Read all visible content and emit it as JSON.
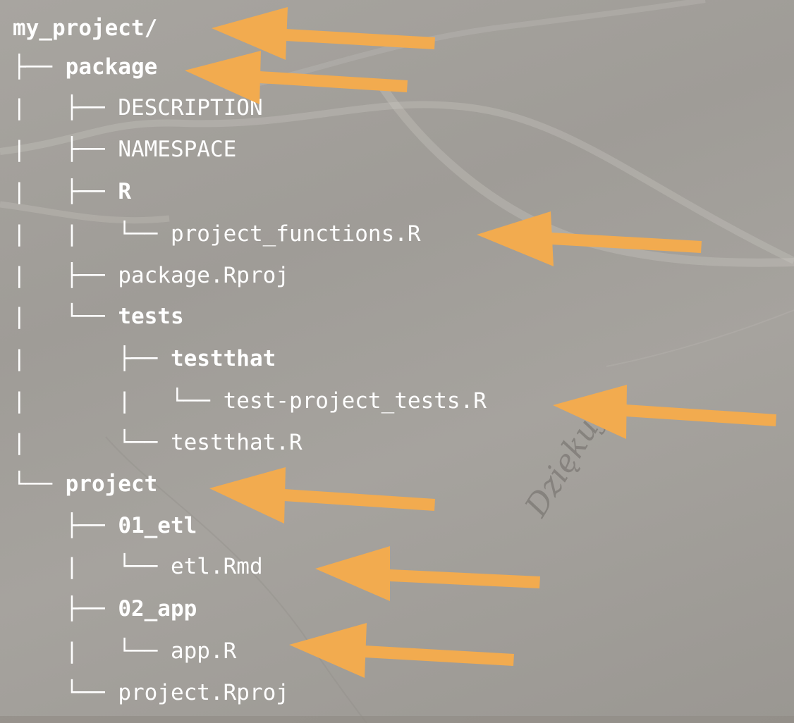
{
  "tree": [
    {
      "prefix": "",
      "label": "my_project/",
      "bold": true
    },
    {
      "prefix": "├── ",
      "label": "package",
      "bold": true
    },
    {
      "prefix": "|   ├── ",
      "label": "DESCRIPTION",
      "bold": false
    },
    {
      "prefix": "|   ├── ",
      "label": "NAMESPACE",
      "bold": false
    },
    {
      "prefix": "|   ├── ",
      "label": "R",
      "bold": true
    },
    {
      "prefix": "|   |   └── ",
      "label": "project_functions.R",
      "bold": false
    },
    {
      "prefix": "|   ├── ",
      "label": "package.Rproj",
      "bold": false
    },
    {
      "prefix": "|   └── ",
      "label": "tests",
      "bold": true
    },
    {
      "prefix": "|       ├── ",
      "label": "testthat",
      "bold": true
    },
    {
      "prefix": "|       |   └── ",
      "label": "test-project_tests.R",
      "bold": false
    },
    {
      "prefix": "|       └── ",
      "label": "testthat.R",
      "bold": false
    },
    {
      "prefix": "└── ",
      "label": "project",
      "bold": true
    },
    {
      "prefix": "    ├── ",
      "label": "01_etl",
      "bold": true
    },
    {
      "prefix": "    |   └── ",
      "label": "etl.Rmd",
      "bold": false
    },
    {
      "prefix": "    ├── ",
      "label": "02_app",
      "bold": true
    },
    {
      "prefix": "    |   └── ",
      "label": "app.R",
      "bold": false
    },
    {
      "prefix": "    └── ",
      "label": "project.Rproj",
      "bold": false
    }
  ],
  "arrows": [
    {
      "points_to": "my_project/"
    },
    {
      "points_to": "package"
    },
    {
      "points_to": "project_functions.R"
    },
    {
      "points_to": "test-project_tests.R"
    },
    {
      "points_to": "project"
    },
    {
      "points_to": "etl.Rmd"
    },
    {
      "points_to": "app.R"
    }
  ],
  "signature": "Dziękuję",
  "colors": {
    "text": "#ffffff",
    "arrow": "#f2ab4f",
    "background": "#a6a39e"
  }
}
